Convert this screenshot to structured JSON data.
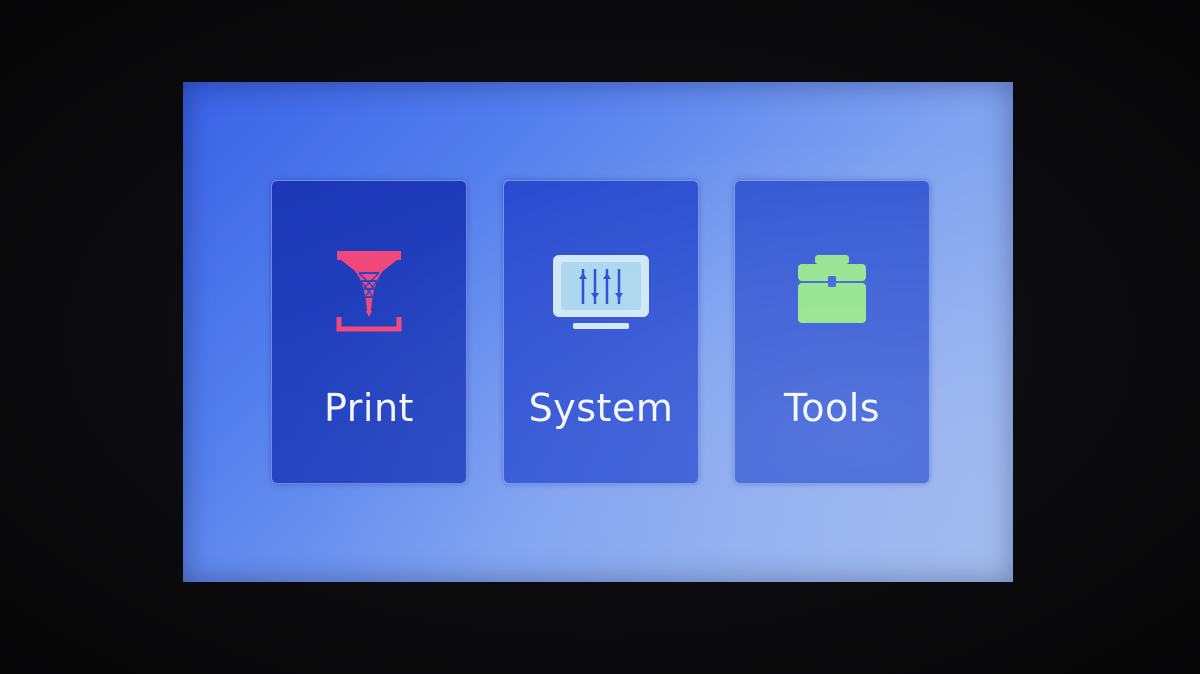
{
  "home_menu": {
    "tiles": [
      {
        "label": "Print",
        "icon": "print-nozzle-icon"
      },
      {
        "label": "System",
        "icon": "system-sliders-icon"
      },
      {
        "label": "Tools",
        "icon": "toolbox-icon"
      }
    ]
  },
  "colors": {
    "print_icon": "#f0487a",
    "system_icon": "#cfe8f6",
    "tools_icon": "#94e48e"
  }
}
